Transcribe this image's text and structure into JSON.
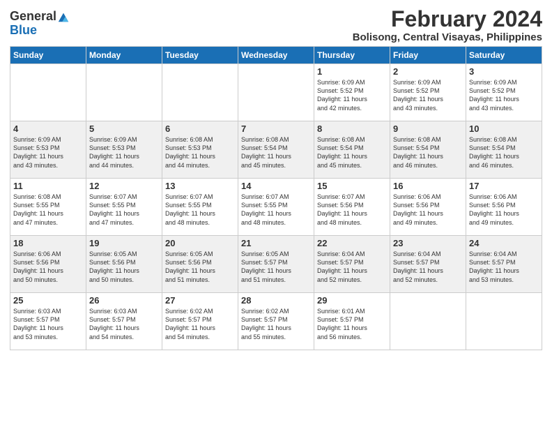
{
  "header": {
    "logo_general": "General",
    "logo_blue": "Blue",
    "title": "February 2024",
    "subtitle": "Bolisong, Central Visayas, Philippines"
  },
  "columns": [
    "Sunday",
    "Monday",
    "Tuesday",
    "Wednesday",
    "Thursday",
    "Friday",
    "Saturday"
  ],
  "weeks": [
    [
      {
        "day": "",
        "info": ""
      },
      {
        "day": "",
        "info": ""
      },
      {
        "day": "",
        "info": ""
      },
      {
        "day": "",
        "info": ""
      },
      {
        "day": "1",
        "info": "Sunrise: 6:09 AM\nSunset: 5:52 PM\nDaylight: 11 hours\nand 42 minutes."
      },
      {
        "day": "2",
        "info": "Sunrise: 6:09 AM\nSunset: 5:52 PM\nDaylight: 11 hours\nand 43 minutes."
      },
      {
        "day": "3",
        "info": "Sunrise: 6:09 AM\nSunset: 5:52 PM\nDaylight: 11 hours\nand 43 minutes."
      }
    ],
    [
      {
        "day": "4",
        "info": "Sunrise: 6:09 AM\nSunset: 5:53 PM\nDaylight: 11 hours\nand 43 minutes."
      },
      {
        "day": "5",
        "info": "Sunrise: 6:09 AM\nSunset: 5:53 PM\nDaylight: 11 hours\nand 44 minutes."
      },
      {
        "day": "6",
        "info": "Sunrise: 6:08 AM\nSunset: 5:53 PM\nDaylight: 11 hours\nand 44 minutes."
      },
      {
        "day": "7",
        "info": "Sunrise: 6:08 AM\nSunset: 5:54 PM\nDaylight: 11 hours\nand 45 minutes."
      },
      {
        "day": "8",
        "info": "Sunrise: 6:08 AM\nSunset: 5:54 PM\nDaylight: 11 hours\nand 45 minutes."
      },
      {
        "day": "9",
        "info": "Sunrise: 6:08 AM\nSunset: 5:54 PM\nDaylight: 11 hours\nand 46 minutes."
      },
      {
        "day": "10",
        "info": "Sunrise: 6:08 AM\nSunset: 5:54 PM\nDaylight: 11 hours\nand 46 minutes."
      }
    ],
    [
      {
        "day": "11",
        "info": "Sunrise: 6:08 AM\nSunset: 5:55 PM\nDaylight: 11 hours\nand 47 minutes."
      },
      {
        "day": "12",
        "info": "Sunrise: 6:07 AM\nSunset: 5:55 PM\nDaylight: 11 hours\nand 47 minutes."
      },
      {
        "day": "13",
        "info": "Sunrise: 6:07 AM\nSunset: 5:55 PM\nDaylight: 11 hours\nand 48 minutes."
      },
      {
        "day": "14",
        "info": "Sunrise: 6:07 AM\nSunset: 5:55 PM\nDaylight: 11 hours\nand 48 minutes."
      },
      {
        "day": "15",
        "info": "Sunrise: 6:07 AM\nSunset: 5:56 PM\nDaylight: 11 hours\nand 48 minutes."
      },
      {
        "day": "16",
        "info": "Sunrise: 6:06 AM\nSunset: 5:56 PM\nDaylight: 11 hours\nand 49 minutes."
      },
      {
        "day": "17",
        "info": "Sunrise: 6:06 AM\nSunset: 5:56 PM\nDaylight: 11 hours\nand 49 minutes."
      }
    ],
    [
      {
        "day": "18",
        "info": "Sunrise: 6:06 AM\nSunset: 5:56 PM\nDaylight: 11 hours\nand 50 minutes."
      },
      {
        "day": "19",
        "info": "Sunrise: 6:05 AM\nSunset: 5:56 PM\nDaylight: 11 hours\nand 50 minutes."
      },
      {
        "day": "20",
        "info": "Sunrise: 6:05 AM\nSunset: 5:56 PM\nDaylight: 11 hours\nand 51 minutes."
      },
      {
        "day": "21",
        "info": "Sunrise: 6:05 AM\nSunset: 5:57 PM\nDaylight: 11 hours\nand 51 minutes."
      },
      {
        "day": "22",
        "info": "Sunrise: 6:04 AM\nSunset: 5:57 PM\nDaylight: 11 hours\nand 52 minutes."
      },
      {
        "day": "23",
        "info": "Sunrise: 6:04 AM\nSunset: 5:57 PM\nDaylight: 11 hours\nand 52 minutes."
      },
      {
        "day": "24",
        "info": "Sunrise: 6:04 AM\nSunset: 5:57 PM\nDaylight: 11 hours\nand 53 minutes."
      }
    ],
    [
      {
        "day": "25",
        "info": "Sunrise: 6:03 AM\nSunset: 5:57 PM\nDaylight: 11 hours\nand 53 minutes."
      },
      {
        "day": "26",
        "info": "Sunrise: 6:03 AM\nSunset: 5:57 PM\nDaylight: 11 hours\nand 54 minutes."
      },
      {
        "day": "27",
        "info": "Sunrise: 6:02 AM\nSunset: 5:57 PM\nDaylight: 11 hours\nand 54 minutes."
      },
      {
        "day": "28",
        "info": "Sunrise: 6:02 AM\nSunset: 5:57 PM\nDaylight: 11 hours\nand 55 minutes."
      },
      {
        "day": "29",
        "info": "Sunrise: 6:01 AM\nSunset: 5:57 PM\nDaylight: 11 hours\nand 56 minutes."
      },
      {
        "day": "",
        "info": ""
      },
      {
        "day": "",
        "info": ""
      }
    ]
  ]
}
